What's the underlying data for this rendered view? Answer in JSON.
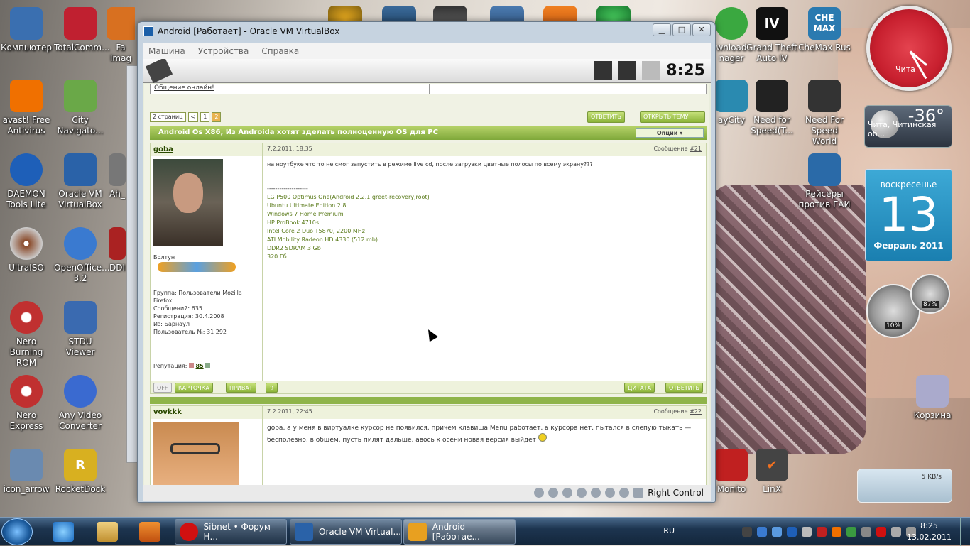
{
  "desktop": {
    "icons_left": [
      {
        "label": "Компьютер",
        "color": "#3a6fb0"
      },
      {
        "label": "TotalComm...",
        "color": "#c02030"
      },
      {
        "label": "Fa\nImag",
        "color": "#d87020"
      },
      {
        "label": "avast! Free Antivirus",
        "color": "#f07000"
      },
      {
        "label": "City Navigato...",
        "color": "#6aa848"
      },
      {
        "label": "DAEMON Tools Lite",
        "color": "#1e5fb8"
      },
      {
        "label": "Oracle VM VirtualBox",
        "color": "#2a62a8"
      },
      {
        "label": "Ah_",
        "color": "#777"
      },
      {
        "label": "UltraISO",
        "color": "#8a4a2a"
      },
      {
        "label": "OpenOffice... 3.2",
        "color": "#3a7ad0"
      },
      {
        "label": "DDI",
        "color": "#aa2222"
      },
      {
        "label": "Nero Burning ROM",
        "color": "#c03030"
      },
      {
        "label": "STDU Viewer",
        "color": "#3a6ab0"
      },
      {
        "label": "Nero Express",
        "color": "#c03030"
      },
      {
        "label": "Any Video Converter",
        "color": "#3a6ad0"
      },
      {
        "label": "icon_arrow",
        "color": "#6a8ab0"
      },
      {
        "label": "RocketDock",
        "color": "#d8b020"
      }
    ],
    "icons_right": [
      {
        "label": "wnload nager",
        "color": "#3aa840"
      },
      {
        "label": "Grand Theft Auto IV",
        "color": "#111"
      },
      {
        "label": "CheMax Rus",
        "color": "#2a7ab0"
      },
      {
        "label": "ayCity",
        "color": "#2a8ab0"
      },
      {
        "label": "Need for Speed(T...",
        "color": "#222"
      },
      {
        "label": "Need For Speed World",
        "color": "#333"
      },
      {
        "label": "Рейсеры против ГАИ",
        "color": "#2a6aa8"
      },
      {
        "label": "Monito",
        "color": "#c02020"
      },
      {
        "label": "LinX",
        "color": "#444"
      },
      {
        "label": "Корзина",
        "color": "#aac"
      }
    ],
    "gadgets": {
      "clock_label": "Чита",
      "weather_temp": "-36°",
      "weather_city": "Чита, Читинская об...",
      "calendar_day": "воскресенье",
      "calendar_num": "13",
      "calendar_month": "Февраль 2011",
      "cpu_meter_pct": "10%",
      "mem_meter_pct": "87%",
      "net_speed": "5 KB/s"
    }
  },
  "window": {
    "title": "Android [Работает] - Oracle VM VirtualBox",
    "menu": [
      "Машина",
      "Устройства",
      "Справка"
    ],
    "status_host_key": "Right Control"
  },
  "android": {
    "time": "8:25",
    "forum": {
      "online_link": "Общение онлайн!",
      "pager_label": "2 страниц",
      "pager_prev": "<",
      "pager_p1": "1",
      "pager_p2": "2",
      "reply_btn": "ОТВЕТИТЬ",
      "new_topic_btn": "ОТКРЫТЬ ТЕМУ",
      "topic_title": "Android Os X86, Из Androida хотят зделать полноценную OS для PC",
      "options_btn": "Опции",
      "post1": {
        "user": "goba",
        "date": "7.2.2011, 18:35",
        "msg_label": "Сообщение",
        "msg_num": "#21",
        "rank": "Болтун",
        "group": "Группа: Пользователи Mozilla Firefox",
        "messages": "Сообщений: 635",
        "reg": "Регистрация: 30.4.2008",
        "from": "Из: Барнаул",
        "usernum": "Пользователь №: 31 292",
        "rep_label": "Репутация:",
        "rep_val": "85",
        "text": "на ноутбуке что то не смог запустить в режиме live cd, после загрузки цветные полосы по всему экрану???",
        "sep": "--------------------",
        "sig": [
          "LG P500 Optimus One(Android 2.2.1 greet-recovery,root)",
          "Ubuntu Ultimate Edition 2.8",
          "Windows 7 Home Premium",
          "HP ProBook 4710s",
          "Intel Core 2 Duo T5870, 2200 MHz",
          "ATI Mobility Radeon HD 4330 (512 mb)",
          "DDR2 SDRAM 3 Gb",
          "320 Гб"
        ],
        "off_btn": "OFF",
        "card_btn": "КАРТОЧКА",
        "priv_btn": "ПРИВАТ",
        "quote_btn": "ЦИТАТА",
        "answer_btn": "ОТВЕТИТЬ"
      },
      "post2": {
        "user": "vovkkk",
        "date": "7.2.2011, 22:45",
        "msg_label": "Сообщение",
        "msg_num": "#22",
        "text": "goba, а у меня в виртуалке курсор не появился, причём клавиша Menu работает, а курсора нет, пытался в слепую тыкать — бесполезно, в общем, пусть пилят дальше, авось к осени новая версия выйдет"
      }
    }
  },
  "taskbar": {
    "buttons": [
      {
        "label": "Sibnet • Форум Н...",
        "color": "#d01010"
      },
      {
        "label": "Oracle VM Virtual...",
        "color": "#2a62a8"
      },
      {
        "label": "Android [Работае...",
        "color": "#e8a020"
      }
    ],
    "lang": "RU",
    "time": "8:25",
    "date": "13.02.2011"
  }
}
